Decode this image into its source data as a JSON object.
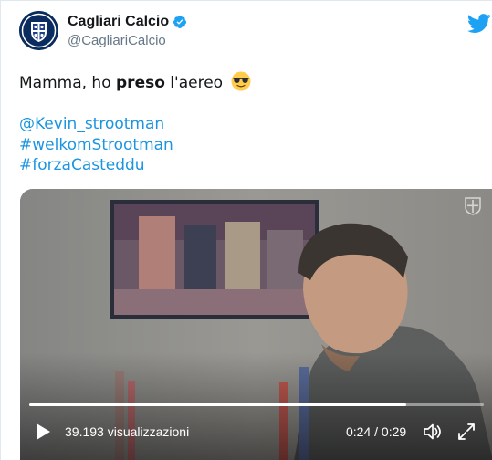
{
  "author": {
    "name": "Cagliari Calcio",
    "handle": "@CagliariCalcio",
    "verified": true,
    "avatar_icon": "cagliari-crest-icon"
  },
  "tweet": {
    "text_before": "Mamma, ho ",
    "text_bold": "preso",
    "text_after": " l'aereo",
    "emoji": "smiling-face-with-sunglasses",
    "links": [
      "@Kevin_strootman",
      "#welkomStrootman",
      "#forzaCasteddu"
    ]
  },
  "video": {
    "views_label": "39.193 visualizzazioni",
    "time_label": "0:24 / 0:29",
    "progress": 0.83,
    "play_icon": "play-icon",
    "volume_icon": "volume-icon",
    "expand_icon": "expand-icon",
    "watermark_icon": "cagliari-crest-icon"
  },
  "colors": {
    "link": "#1b95e0",
    "verified": "#1da1f2",
    "twitter_bird": "#1da1f2",
    "text": "#14171a",
    "muted": "#657786"
  }
}
